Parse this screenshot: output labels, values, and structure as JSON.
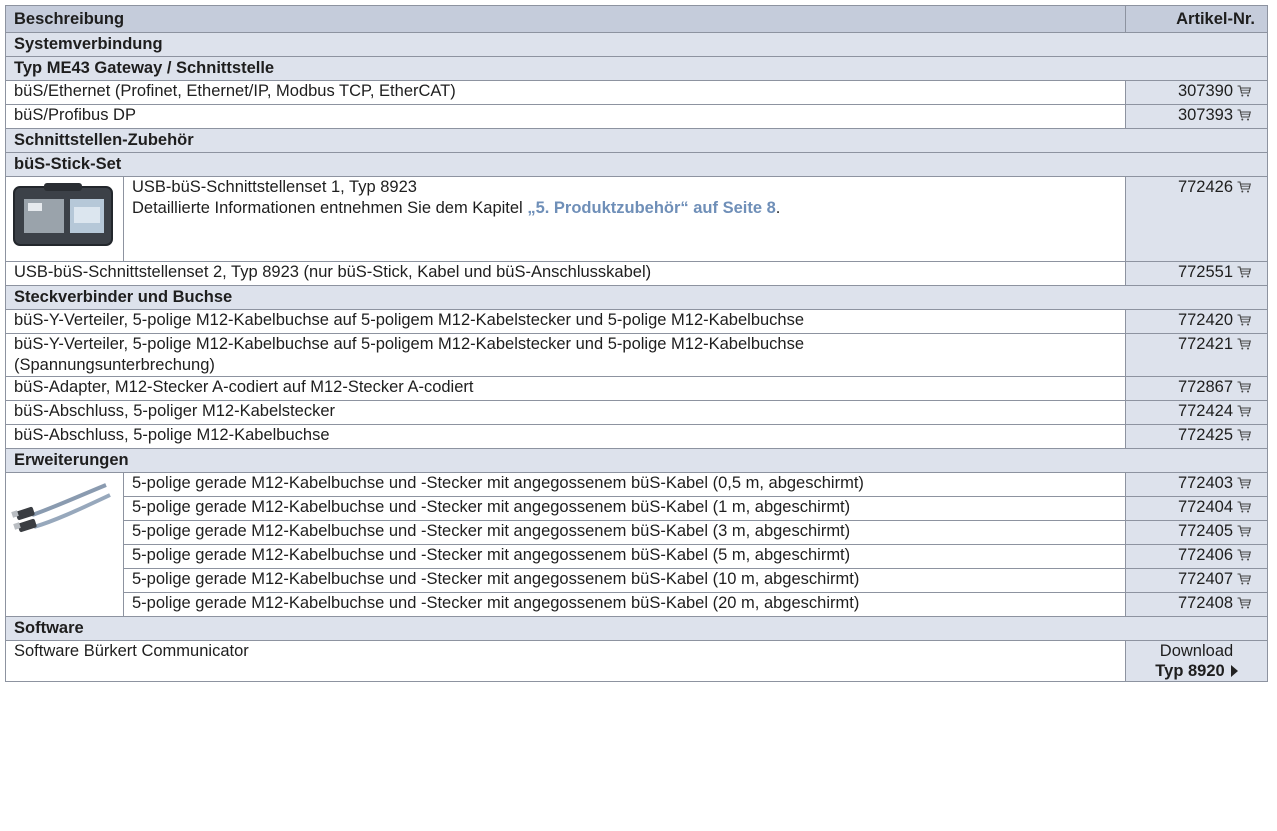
{
  "header": {
    "description": "Beschreibung",
    "article": "Artikel-Nr."
  },
  "sections": {
    "system": "Systemverbindung",
    "gateway": "Typ ME43 Gateway / Schnittstelle",
    "iface_acc": "Schnittstellen-Zubehör",
    "stick_set": "büS-Stick-Set",
    "connectors": "Steckverbinder und Buchse",
    "extensions": "Erweiterungen",
    "software": "Software"
  },
  "gateway_rows": [
    {
      "desc": "büS/Ethernet (Profinet, Ethernet/IP, Modbus TCP, EtherCAT)",
      "art": "307390"
    },
    {
      "desc": "büS/Profibus DP",
      "art": "307393"
    }
  ],
  "stick": {
    "line1": "USB-büS-Schnittstellenset 1, Typ 8923",
    "line2_prefix": "Detaillierte Informationen entnehmen Sie dem Kapitel ",
    "line2_link": "„5. Produktzubehör“ auf Seite 8",
    "line2_suffix": ".",
    "art": "772426",
    "row2_desc": "USB-büS-Schnittstellenset 2, Typ 8923 (nur büS-Stick, Kabel und büS-Anschlusskabel)",
    "row2_art": "772551"
  },
  "connector_rows": [
    {
      "desc": "büS-Y-Verteiler, 5-polige M12-Kabelbuchse auf 5-poligem M12-Kabelstecker und 5-polige M12-Kabelbuchse",
      "art": "772420"
    },
    {
      "desc": "büS-Y-Verteiler, 5-polige M12-Kabelbuchse auf 5-poligem M12-Kabelstecker und 5-polige M12-Kabelbuchse",
      "desc2": "(Spannungsunterbrechung)",
      "art": "772421"
    },
    {
      "desc": "büS-Adapter, M12-Stecker A-codiert auf M12-Stecker A-codiert",
      "art": "772867"
    },
    {
      "desc": "büS-Abschluss, 5-poliger M12-Kabelstecker",
      "art": "772424"
    },
    {
      "desc": "büS-Abschluss, 5-polige M12-Kabelbuchse",
      "art": "772425"
    }
  ],
  "extension_rows": [
    {
      "desc": "5-polige gerade M12-Kabelbuchse und -Stecker mit angegossenem büS-Kabel (0,5 m, abgeschirmt)",
      "art": "772403"
    },
    {
      "desc": "5-polige gerade M12-Kabelbuchse und -Stecker mit angegossenem büS-Kabel (1 m, abgeschirmt)",
      "art": "772404"
    },
    {
      "desc": "5-polige gerade M12-Kabelbuchse und -Stecker mit angegossenem büS-Kabel (3 m, abgeschirmt)",
      "art": "772405"
    },
    {
      "desc": "5-polige gerade M12-Kabelbuchse und -Stecker mit angegossenem büS-Kabel (5 m, abgeschirmt)",
      "art": "772406"
    },
    {
      "desc": "5-polige gerade M12-Kabelbuchse und -Stecker mit angegossenem büS-Kabel (10 m, abgeschirmt)",
      "art": "772407"
    },
    {
      "desc": "5-polige gerade M12-Kabelbuchse und -Stecker mit angegossenem büS-Kabel (20 m, abgeschirmt)",
      "art": "772408"
    }
  ],
  "software_row": {
    "desc": "Software Bürkert Communicator",
    "art_line1": "Download",
    "art_line2": "Typ 8920"
  },
  "colors": {
    "header_bg": "#c5ccdb",
    "section_bg": "#dde2ec",
    "link": "#6f8fb8",
    "border": "#8d93a0"
  },
  "icons": {
    "cart": "shopping-cart-icon",
    "arrow": "triangle-right-icon"
  }
}
